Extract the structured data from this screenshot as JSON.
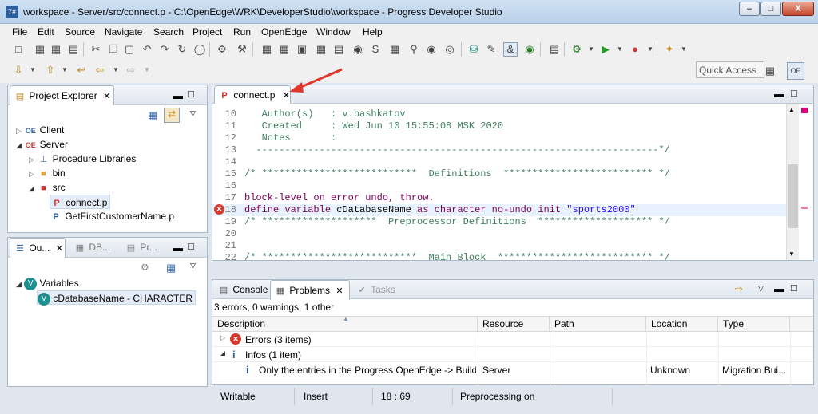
{
  "window": {
    "title": "workspace - Server/src/connect.p - C:\\OpenEdge\\WRK\\DeveloperStudio\\workspace - Progress Developer Studio",
    "minimize_label": "–",
    "maximize_label": "□",
    "close_label": "X"
  },
  "menu": [
    "File",
    "Edit",
    "Source",
    "Navigate",
    "Search",
    "Project",
    "Run",
    "OpenEdge",
    "Window",
    "Help"
  ],
  "toolbar": {
    "quick_access_label": "Quick Access"
  },
  "project_explorer": {
    "title": "Project Explorer",
    "items": [
      {
        "label": "Client"
      },
      {
        "label": "Server"
      },
      {
        "label": "Procedure Libraries"
      },
      {
        "label": "bin"
      },
      {
        "label": "src"
      },
      {
        "label": "connect.p"
      },
      {
        "label": "GetFirstCustomerName.p"
      }
    ]
  },
  "outline": {
    "tabs": [
      "Ou...",
      "DB...",
      "Pr..."
    ],
    "items": [
      {
        "label": "Variables"
      },
      {
        "label": "cDatabaseName - CHARACTER"
      }
    ]
  },
  "editor": {
    "tab_label": "connect.p",
    "lines": [
      {
        "n": "10",
        "parts": [
          {
            "t": "   Author(s)   : v.bashkatov",
            "c": "c-cm"
          }
        ]
      },
      {
        "n": "11",
        "parts": [
          {
            "t": "   Created     : Wed Jun 10 15:55:08 MSK 2020",
            "c": "c-cm"
          }
        ]
      },
      {
        "n": "12",
        "parts": [
          {
            "t": "   Notes       :",
            "c": "c-cm"
          }
        ]
      },
      {
        "n": "13",
        "parts": [
          {
            "t": "  ----------------------------------------------------------------------*/",
            "c": "c-cm"
          }
        ]
      },
      {
        "n": "14",
        "parts": [
          {
            "t": "",
            "c": ""
          }
        ]
      },
      {
        "n": "15",
        "parts": [
          {
            "t": "/* ***************************  Definitions  ************************** */",
            "c": "c-cm"
          }
        ]
      },
      {
        "n": "16",
        "parts": [
          {
            "t": "",
            "c": ""
          }
        ]
      },
      {
        "n": "17",
        "parts": [
          {
            "t": "block-level on error undo, throw.",
            "c": "c-kw"
          }
        ]
      },
      {
        "n": "18",
        "parts": [
          {
            "t": "define variable ",
            "c": "c-kw"
          },
          {
            "t": "cDatabaseName ",
            "c": ""
          },
          {
            "t": "as ",
            "c": "c-kw"
          },
          {
            "t": "character ",
            "c": "c-kw"
          },
          {
            "t": "no-undo init ",
            "c": "c-kw"
          },
          {
            "t": "\"sports2000\"",
            "c": "c-str"
          }
        ]
      },
      {
        "n": "19",
        "parts": [
          {
            "t": "/* ********************  Preprocessor Definitions  ******************** */",
            "c": "c-cm"
          }
        ]
      },
      {
        "n": "20",
        "parts": [
          {
            "t": "",
            "c": ""
          }
        ]
      },
      {
        "n": "21",
        "parts": [
          {
            "t": "",
            "c": ""
          }
        ]
      },
      {
        "n": "22",
        "parts": [
          {
            "t": "/* ***************************  Main Block  *************************** */",
            "c": "c-cm"
          }
        ]
      }
    ]
  },
  "bottom": {
    "tabs": [
      "Console",
      "Problems",
      "Tasks"
    ],
    "summary": "3 errors, 0 warnings, 1 other",
    "columns": [
      "Description",
      "Resource",
      "Path",
      "Location",
      "Type"
    ],
    "rows": [
      {
        "description": "Errors (3 items)",
        "resource": "",
        "path": "",
        "location": "",
        "type": ""
      },
      {
        "description": "Infos (1 item)",
        "resource": "",
        "path": "",
        "location": "",
        "type": ""
      },
      {
        "description": "Only the entries in the Progress OpenEdge -> Build -",
        "resource": "Server",
        "path": "",
        "location": "Unknown",
        "type": "Migration Bui..."
      }
    ]
  },
  "status": {
    "writable": "Writable",
    "insert": "Insert",
    "position": "18 : 69",
    "preprocessing": "Preprocessing on"
  },
  "colors": {
    "arrow": "#e0362c",
    "error": "#d33b2c",
    "accent": "#2d5f9e"
  }
}
